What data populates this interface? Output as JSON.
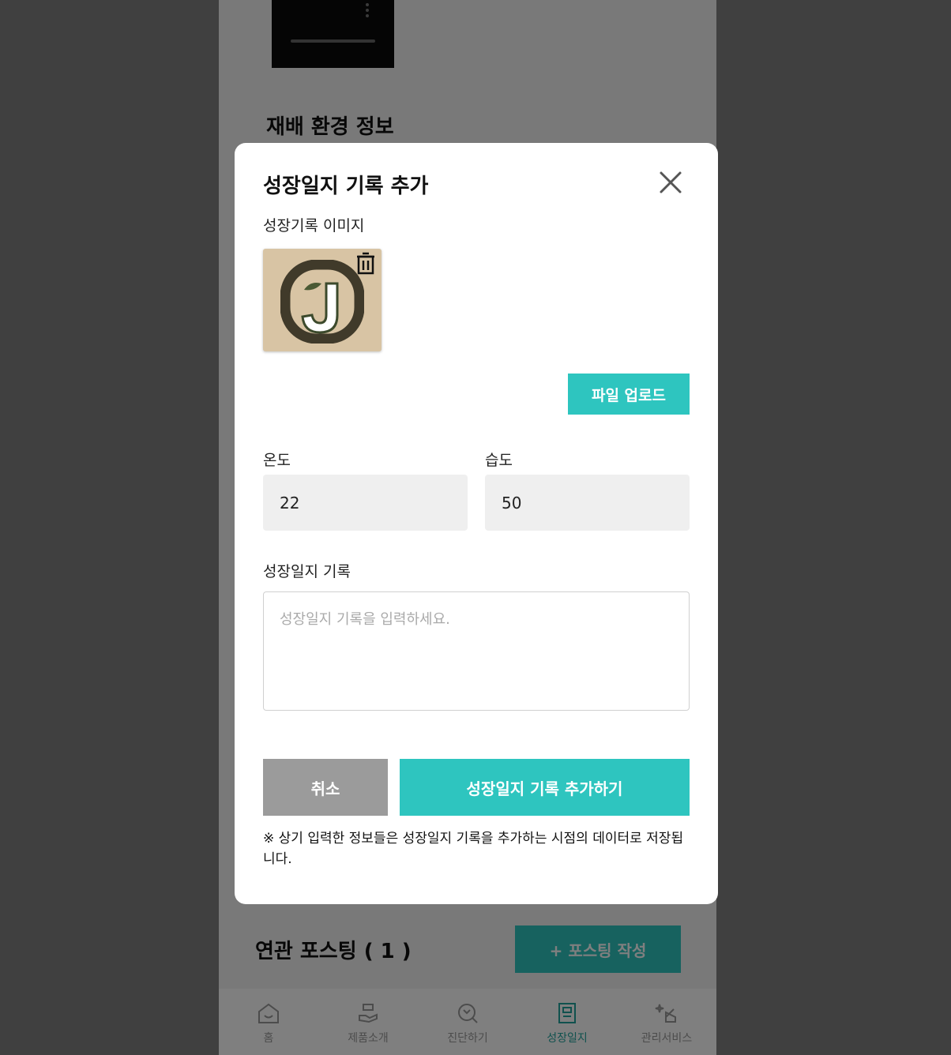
{
  "background": {
    "section_title": "재배 환경 정보",
    "related_title": "연관 포스팅 ( 1 )",
    "posting_button_label": "+ 포스팅 작성"
  },
  "nav": {
    "items": [
      {
        "label": "홈",
        "icon": "home-icon",
        "active": false
      },
      {
        "label": "제품소개",
        "icon": "product-icon",
        "active": false
      },
      {
        "label": "진단하기",
        "icon": "diagnose-icon",
        "active": false
      },
      {
        "label": "성장일지",
        "icon": "journal-icon",
        "active": true
      },
      {
        "label": "관리서비스",
        "icon": "care-service-icon",
        "active": false
      }
    ]
  },
  "modal": {
    "title": "성장일지 기록 추가",
    "image_label": "성장기록 이미지",
    "upload_button_label": "파일 업로드",
    "temperature_label": "온도",
    "temperature_value": "22",
    "humidity_label": "습도",
    "humidity_value": "50",
    "record_label": "성장일지 기록",
    "record_placeholder": "성장일지 기록을 입력하세요.",
    "cancel_label": "취소",
    "submit_label": "성장일지 기록 추가하기",
    "notice": "※ 상기 입력한 정보들은 성장일지 기록을 추가하는 시점의 데이터로 저장됩니다."
  },
  "colors": {
    "accent": "#2ec5bf",
    "cancel": "#9b9b9b"
  }
}
